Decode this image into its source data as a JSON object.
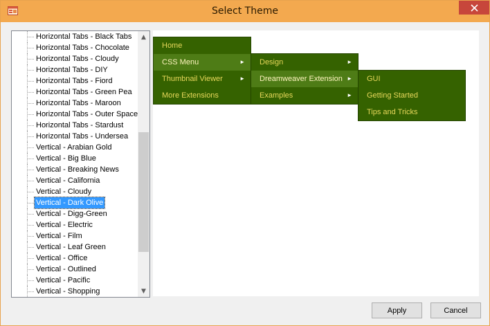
{
  "window": {
    "title": "Select Theme",
    "close_glyph": "✕"
  },
  "tree": {
    "items": [
      {
        "label": "Horizontal Tabs - Black Tabs"
      },
      {
        "label": "Horizontal Tabs - Chocolate"
      },
      {
        "label": "Horizontal Tabs - Cloudy"
      },
      {
        "label": "Horizontal Tabs - DIY"
      },
      {
        "label": "Horizontal Tabs - Fiord"
      },
      {
        "label": "Horizontal Tabs - Green Pea"
      },
      {
        "label": "Horizontal Tabs - Maroon"
      },
      {
        "label": "Horizontal Tabs - Outer Space"
      },
      {
        "label": "Horizontal Tabs - Stardust"
      },
      {
        "label": "Horizontal Tabs - Undersea"
      },
      {
        "label": "Vertical - Arabian Gold"
      },
      {
        "label": "Vertical - Big Blue"
      },
      {
        "label": "Vertical - Breaking News"
      },
      {
        "label": "Vertical - California"
      },
      {
        "label": "Vertical - Cloudy"
      },
      {
        "label": "Vertical - Dark Olive",
        "selected": true
      },
      {
        "label": "Vertical - Digg-Green"
      },
      {
        "label": "Vertical - Electric"
      },
      {
        "label": "Vertical - Film"
      },
      {
        "label": "Vertical - Leaf Green"
      },
      {
        "label": "Vertical - Office"
      },
      {
        "label": "Vertical - Outlined"
      },
      {
        "label": "Vertical - Pacific"
      },
      {
        "label": "Vertical - Shopping"
      }
    ],
    "selected_index": 15,
    "scroll": {
      "up_glyph": "▲",
      "down_glyph": "▼"
    }
  },
  "preview": {
    "menu1": [
      {
        "label": "Home"
      },
      {
        "label": "CSS Menu",
        "has_submenu": true,
        "active": true
      },
      {
        "label": "Thumbnail Viewer",
        "has_submenu": true
      },
      {
        "label": "More Extensions"
      }
    ],
    "menu2": [
      {
        "label": "Design",
        "has_submenu": true
      },
      {
        "label": "Dreamweaver Extension",
        "has_submenu": true,
        "active": true
      },
      {
        "label": "Examples",
        "has_submenu": true
      }
    ],
    "menu3": [
      {
        "label": "GUI"
      },
      {
        "label": "Getting Started"
      },
      {
        "label": "Tips and Tricks"
      }
    ],
    "arrow_glyph": "►",
    "colors": {
      "menu_bg": "#356200",
      "menu_active_bg": "#4e7c16",
      "menu_text": "#e8d85a"
    }
  },
  "buttons": {
    "apply": "Apply",
    "cancel": "Cancel"
  },
  "colors": {
    "titlebar": "#f3a94f",
    "close": "#c7463b",
    "selection": "#3399ff"
  }
}
